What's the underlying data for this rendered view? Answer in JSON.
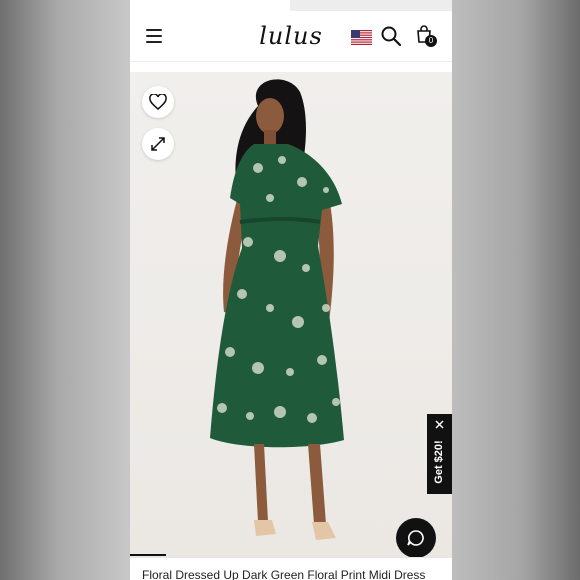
{
  "header": {
    "logo_text": "lulus",
    "menu_icon": "hamburger-menu-icon",
    "region_icon": "us-flag-icon",
    "search_icon": "search-icon",
    "bag_icon": "shopping-bag-icon",
    "bag_count": "0"
  },
  "product": {
    "title": "Floral Dressed Up Dark Green Floral Print Midi Dress",
    "image_alt": "Model wearing dark green floral print midi dress",
    "favorite_icon": "heart-icon",
    "zoom_icon": "expand-icon"
  },
  "promo": {
    "label": "Get $20!",
    "close_icon": "close-icon"
  },
  "chat": {
    "icon": "chat-bubble-icon"
  },
  "colors": {
    "dress_green": "#1f5a3b",
    "accent_dark": "#111111"
  }
}
